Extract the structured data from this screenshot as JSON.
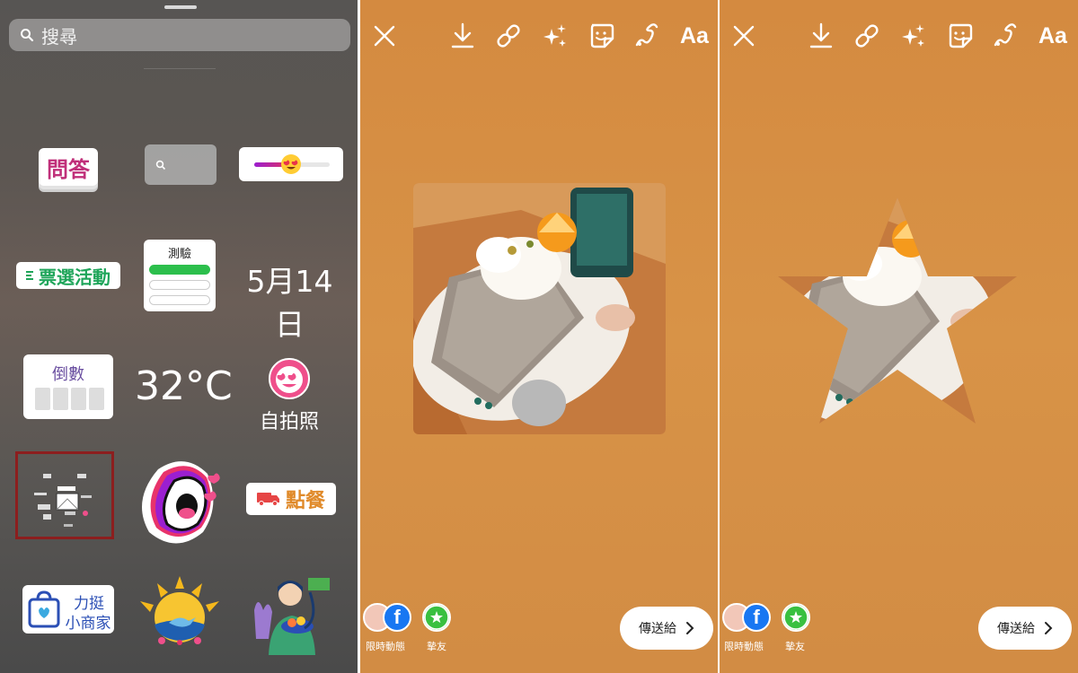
{
  "sticker_tray": {
    "search_placeholder": "搜尋",
    "stickers": {
      "questions": "問答",
      "poll": "票選活動",
      "quiz": "測驗",
      "date": "5月14日",
      "countdown": "倒數",
      "temperature": "32°C",
      "selfie": "自拍照",
      "food_order": "點餐",
      "support_small_business_line1": "力挺",
      "support_small_business_line2": "小商家"
    }
  },
  "editor_left": {
    "toolbar": {
      "text_tool": "Aa"
    },
    "share": {
      "your_story_label": "限時動態",
      "close_friends_label": "摯友",
      "send_to_label": "傳送給"
    }
  },
  "editor_right": {
    "toolbar": {
      "text_tool": "Aa"
    },
    "share": {
      "your_story_label": "限時動態",
      "close_friends_label": "摯友",
      "send_to_label": "傳送給"
    }
  },
  "colors": {
    "story_background": "#d48a40",
    "selected_sticker_outline": "#8c1e1e",
    "close_friends_green": "#39c040",
    "facebook_blue": "#1877f2"
  }
}
